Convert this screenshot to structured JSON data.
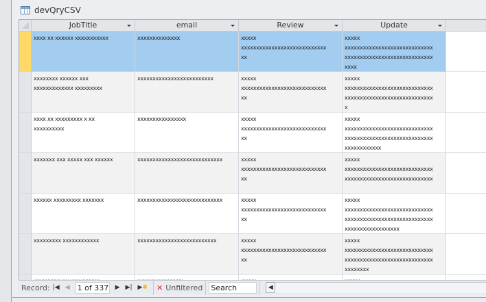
{
  "window": {
    "title": "devQryCSV"
  },
  "columns": [
    "JobTitle",
    "email",
    "Review",
    "Update"
  ],
  "rows": [
    [
      "xxxx xx xxxxxx xxxxxxxxxxx",
      "xxxxxxxxxxxxxx",
      "xxxxx\nxxxxxxxxxxxxxxxxxxxxxxxxxxxx\nxx",
      "xxxxx\nxxxxxxxxxxxxxxxxxxxxxxxxxxxxx\nxxxxxxxxxxxxxxxxxxxxxxxxxxxxx\nxxxx"
    ],
    [
      "xxxxxxxx xxxxxx xxx\nxxxxxxxxxxxxx xxxxxxxxx",
      "xxxxxxxxxxxxxxxxxxxxxxxxx",
      "xxxxx\nxxxxxxxxxxxxxxxxxxxxxxxxxxxx\nxx",
      "xxxxx\nxxxxxxxxxxxxxxxxxxxxxxxxxxxxx\nxxxxxxxxxxxxxxxxxxxxxxxxxxxxx\nx"
    ],
    [
      "xxxx xx xxxxxxxxx x xx\nxxxxxxxxxx",
      "xxxxxxxxxxxxxxxx",
      "xxxxx\nxxxxxxxxxxxxxxxxxxxxxxxxxxxx\nxx",
      "xxxxx\nxxxxxxxxxxxxxxxxxxxxxxxxxxxxx\nxxxxxxxxxxxxxxxxxxxxxxxxxxxxx\nxxxxxxxxxxxx"
    ],
    [
      "xxxxxxx xxx xxxxx xxx xxxxxx",
      "xxxxxxxxxxxxxxxxxxxxxxxxxxxx",
      "xxxxx\nxxxxxxxxxxxxxxxxxxxxxxxxxxxx\nxx",
      "xxxxx\nxxxxxxxxxxxxxxxxxxxxxxxxxxxxx\nxxxxxxxxxxxxxxxxxxxxxxxxxxxxx"
    ],
    [
      "xxxxxx xxxxxxxxx xxxxxxx",
      "xxxxxxxxxxxxxxxxxxxxxxxxxxxx",
      "xxxxx\nxxxxxxxxxxxxxxxxxxxxxxxxxxxx\nxx",
      "xxxxx\nxxxxxxxxxxxxxxxxxxxxxxxxxxxxx\nxxxxxxxxxxxxxxxxxxxxxxxxxxxxx\nxxxxxxxxxxxxxxxxxx"
    ],
    [
      "xxxxxxxxx xxxxxxxxxxxx",
      "xxxxxxxxxxxxxxxxxxxxxxxxxx",
      "xxxxx\nxxxxxxxxxxxxxxxxxxxxxxxxxxxx\nxx",
      "xxxxx\nxxxxxxxxxxxxxxxxxxxxxxxxxxxxx\nxxxxxxxxxxxxxxxxxxxxxxxxxxxxx\nxxxxxxxx"
    ],
    [
      "xxxxxxxxx xx xxx xxxxxx",
      "xxxxxxxxxxxxxxx",
      "xxxxx",
      "xxxxx"
    ]
  ],
  "nav": {
    "record_label": "Record:",
    "current": "1 of 337",
    "filter_label": "Unfiltered",
    "search_placeholder": "Search"
  },
  "colors": {
    "selected_row": "#a3cdf0",
    "record_selector": "#ffd966"
  }
}
